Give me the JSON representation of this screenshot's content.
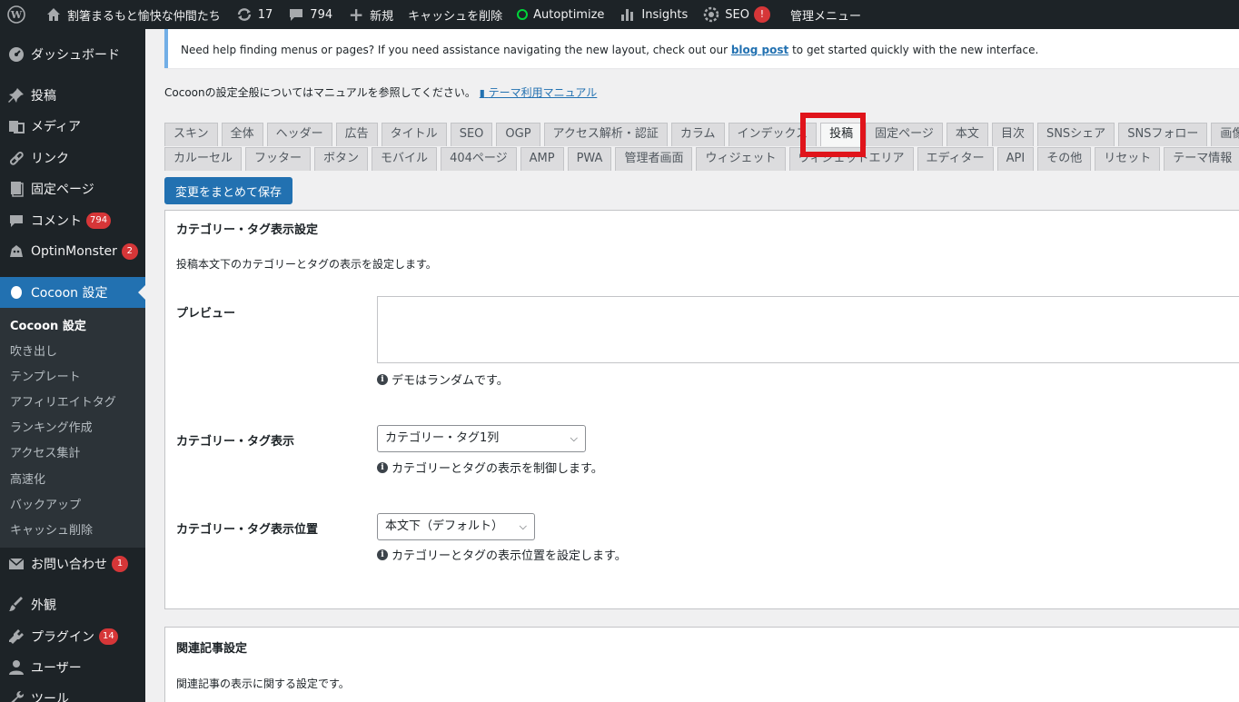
{
  "adminbar": {
    "site_name": "割箸まるもと愉快な仲間たち",
    "updates": "17",
    "comments": "794",
    "new_label": "新規",
    "clear_cache": "キャッシュを削除",
    "autoptimize": "Autoptimize",
    "insights": "Insights",
    "seo": "SEO",
    "seo_badge": "!",
    "admin_menu": "管理メニュー"
  },
  "sidebar": {
    "dashboard": "ダッシュボード",
    "posts": "投稿",
    "media": "メディア",
    "links": "リンク",
    "pages": "固定ページ",
    "comments": "コメント",
    "comments_count": "794",
    "optinmonster": "OptinMonster",
    "optinmonster_count": "2",
    "cocoon": "Cocoon 設定",
    "submenu": [
      "Cocoon 設定",
      "吹き出し",
      "テンプレート",
      "アフィリエイトタグ",
      "ランキング作成",
      "アクセス集計",
      "高速化",
      "バックアップ",
      "キャッシュ削除"
    ],
    "contact": "お問い合わせ",
    "contact_count": "1",
    "appearance": "外観",
    "plugins": "プラグイン",
    "plugins_count": "14",
    "users": "ユーザー",
    "tools": "ツール"
  },
  "notice": {
    "text_before": "Need help finding menus or pages? If you need assistance navigating the new layout, check out our ",
    "link": "blog post",
    "text_after": " to get started quickly with the new interface."
  },
  "manual": {
    "text": "Cocoonの設定全般についてはマニュアルを参照してください。",
    "link": "テーマ利用マニュアル"
  },
  "tabs_row1": [
    "スキン",
    "全体",
    "ヘッダー",
    "広告",
    "タイトル",
    "SEO",
    "OGP",
    "アクセス解析・認証",
    "カラム",
    "インデックス",
    "投稿",
    "固定ページ",
    "本文",
    "目次",
    "SNSシェア",
    "SNSフォロー",
    "画像"
  ],
  "tabs_row2": [
    "カルーセル",
    "フッター",
    "ボタン",
    "モバイル",
    "404ページ",
    "AMP",
    "PWA",
    "管理者画面",
    "ウィジェット",
    "ウィジェットエリア",
    "エディター",
    "API",
    "その他",
    "リセット",
    "テーマ情報"
  ],
  "save_button": "変更をまとめて保存",
  "box1": {
    "title": "カテゴリー・タグ表示設定",
    "desc": "投稿本文下のカテゴリーとタグの表示を設定します。",
    "preview_label": "プレビュー",
    "preview_help": "デモはランダムです。",
    "display_label": "カテゴリー・タグ表示",
    "display_value": "カテゴリー・タグ1列",
    "display_help": "カテゴリーとタグの表示を制御します。",
    "position_label": "カテゴリー・タグ表示位置",
    "position_value": "本文下（デフォルト）",
    "position_help": "カテゴリーとタグの表示位置を設定します。"
  },
  "box2": {
    "title": "関連記事設定",
    "desc": "関連記事の表示に関する設定です。"
  }
}
